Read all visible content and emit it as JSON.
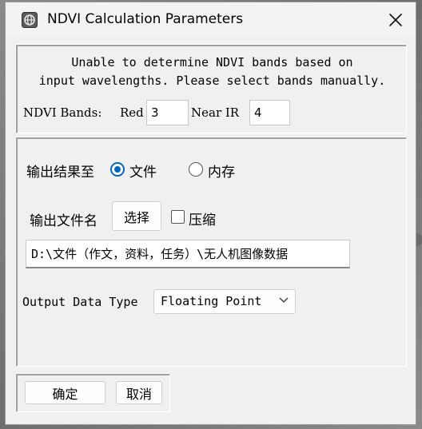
{
  "window": {
    "title": "NDVI Calculation Parameters",
    "app_icon": "envi-globe-icon",
    "close_icon": "close-icon"
  },
  "ndvi": {
    "message_line1": "Unable to determine NDVI bands based on",
    "message_line2": "input wavelengths.  Please select bands manually.",
    "bands_label": "NDVI Bands:",
    "red_label": "Red",
    "red_value": "3",
    "nir_label": "Near IR",
    "nir_value": "4"
  },
  "output": {
    "output_to_label": "输出结果至",
    "option_file": "文件",
    "option_memory": "内存",
    "selected": "file",
    "filename_label": "输出文件名",
    "choose_button": "选择",
    "compress_label": "压缩",
    "compress_checked": false,
    "path_value": "D:\\文件（作文，资料，任务）\\无人机图像数据",
    "data_type_label": "Output Data Type",
    "data_type_value": "Floating Point"
  },
  "buttons": {
    "ok": "确定",
    "cancel": "取消"
  },
  "colors": {
    "accent": "#0067c0",
    "dialog_bg": "#f0f0f0"
  }
}
